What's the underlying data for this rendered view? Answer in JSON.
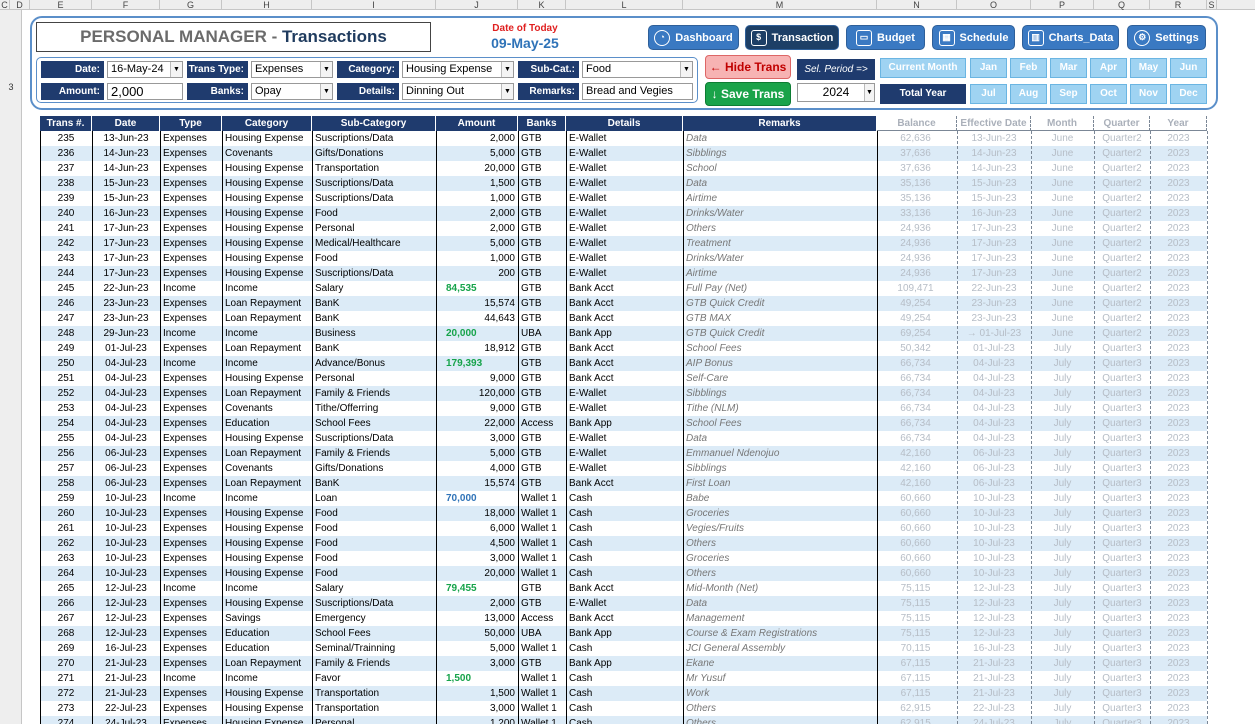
{
  "sheet": {
    "columns": [
      "C",
      "D",
      "E",
      "F",
      "G",
      "H",
      "I",
      "J",
      "K",
      "L",
      "M",
      "N",
      "O",
      "P",
      "Q",
      "R",
      "S"
    ],
    "row_number": "3"
  },
  "header": {
    "app_title": "PERSONAL MANAGER",
    "separator": " - ",
    "page_title": "Transactions",
    "today_label": "Date of Today",
    "today_value": "09-May-25"
  },
  "nav": [
    {
      "label": "Dashboard",
      "icon": "gauge-icon"
    },
    {
      "label": "Transaction",
      "icon": "register-icon"
    },
    {
      "label": "Budget",
      "icon": "wallet-icon"
    },
    {
      "label": "Schedule",
      "icon": "calendar-icon"
    },
    {
      "label": "Charts_Data",
      "icon": "bar-chart-icon"
    },
    {
      "label": "Settings",
      "icon": "gear-icon"
    }
  ],
  "form": {
    "date_label": "Date:",
    "date_value": "16-May-24",
    "type_label": "Trans Type:",
    "type_value": "Expenses",
    "category_label": "Category:",
    "category_value": "Housing Expense",
    "subcat_label": "Sub-Cat.:",
    "subcat_value": "Food",
    "amount_label": "Amount:",
    "amount_value": "2,000",
    "banks_label": "Banks:",
    "banks_value": "Opay",
    "details_label": "Details:",
    "details_value": "Dinning Out",
    "remarks_label": "Remarks:",
    "remarks_value": "Bread and Vegies"
  },
  "buttons": {
    "hide_trans": "Hide Trans",
    "save_trans": "Save Trans"
  },
  "period": {
    "label": "Sel. Period =>",
    "year": "2024",
    "current_month": "Current Month",
    "total_year": "Total Year",
    "months": [
      "Jan",
      "Feb",
      "Mar",
      "Apr",
      "May",
      "Jun",
      "Jul",
      "Aug",
      "Sep",
      "Oct",
      "Nov",
      "Dec"
    ]
  },
  "colors": {
    "accent": "#3a79c2",
    "header_navy": "#1f3b6e",
    "income_green": "#16a34a",
    "income_blue": "#2f73b8",
    "stripe": "#dcebf7"
  },
  "table": {
    "headers": [
      "Trans #.",
      "Date",
      "Type",
      "Category",
      "Sub-Category",
      "Amount",
      "Banks",
      "Details",
      "Remarks",
      "Balance",
      "Effective Date",
      "Month",
      "Quarter",
      "Year"
    ],
    "rows": [
      [
        "235",
        "13-Jun-23",
        "Expenses",
        "Housing Expense",
        "Suscriptions/Data",
        "2,000",
        "GTB",
        "E-Wallet",
        "Data",
        "62,636",
        "13-Jun-23",
        "June",
        "Quarter2",
        "2023"
      ],
      [
        "236",
        "14-Jun-23",
        "Expenses",
        "Covenants",
        "Gifts/Donations",
        "5,000",
        "GTB",
        "E-Wallet",
        "Sibblings",
        "37,636",
        "14-Jun-23",
        "June",
        "Quarter2",
        "2023"
      ],
      [
        "237",
        "14-Jun-23",
        "Expenses",
        "Housing Expense",
        "Transportation",
        "20,000",
        "GTB",
        "E-Wallet",
        "School",
        "37,636",
        "14-Jun-23",
        "June",
        "Quarter2",
        "2023"
      ],
      [
        "238",
        "15-Jun-23",
        "Expenses",
        "Housing Expense",
        "Suscriptions/Data",
        "1,500",
        "GTB",
        "E-Wallet",
        "Data",
        "35,136",
        "15-Jun-23",
        "June",
        "Quarter2",
        "2023"
      ],
      [
        "239",
        "15-Jun-23",
        "Expenses",
        "Housing Expense",
        "Suscriptions/Data",
        "1,000",
        "GTB",
        "E-Wallet",
        "Airtime",
        "35,136",
        "15-Jun-23",
        "June",
        "Quarter2",
        "2023"
      ],
      [
        "240",
        "16-Jun-23",
        "Expenses",
        "Housing Expense",
        "Food",
        "2,000",
        "GTB",
        "E-Wallet",
        "Drinks/Water",
        "33,136",
        "16-Jun-23",
        "June",
        "Quarter2",
        "2023"
      ],
      [
        "241",
        "17-Jun-23",
        "Expenses",
        "Housing Expense",
        "Personal",
        "2,000",
        "GTB",
        "E-Wallet",
        "Others",
        "24,936",
        "17-Jun-23",
        "June",
        "Quarter2",
        "2023"
      ],
      [
        "242",
        "17-Jun-23",
        "Expenses",
        "Housing Expense",
        "Medical/Healthcare",
        "5,000",
        "GTB",
        "E-Wallet",
        "Treatment",
        "24,936",
        "17-Jun-23",
        "June",
        "Quarter2",
        "2023"
      ],
      [
        "243",
        "17-Jun-23",
        "Expenses",
        "Housing Expense",
        "Food",
        "1,000",
        "GTB",
        "E-Wallet",
        "Drinks/Water",
        "24,936",
        "17-Jun-23",
        "June",
        "Quarter2",
        "2023"
      ],
      [
        "244",
        "17-Jun-23",
        "Expenses",
        "Housing Expense",
        "Suscriptions/Data",
        "200",
        "GTB",
        "E-Wallet",
        "Airtime",
        "24,936",
        "17-Jun-23",
        "June",
        "Quarter2",
        "2023"
      ],
      [
        "245",
        "22-Jun-23",
        "Income",
        "Income",
        "Salary",
        "84,535",
        "GTB",
        "Bank Acct",
        "Full Pay (Net)",
        "109,471",
        "22-Jun-23",
        "June",
        "Quarter2",
        "2023"
      ],
      [
        "246",
        "23-Jun-23",
        "Expenses",
        "Loan Repayment",
        "BanK",
        "15,574",
        "GTB",
        "Bank Acct",
        "GTB Quick Credit",
        "49,254",
        "23-Jun-23",
        "June",
        "Quarter2",
        "2023"
      ],
      [
        "247",
        "23-Jun-23",
        "Expenses",
        "Loan Repayment",
        "BanK",
        "44,643",
        "GTB",
        "Bank Acct",
        "GTB MAX",
        "49,254",
        "23-Jun-23",
        "June",
        "Quarter2",
        "2023"
      ],
      [
        "248",
        "29-Jun-23",
        "Income",
        "Income",
        "Business",
        "20,000",
        "UBA",
        "Bank App",
        "GTB Quick Credit",
        "69,254",
        "→ 01-Jul-23",
        "June",
        "Quarter2",
        "2023"
      ],
      [
        "249",
        "01-Jul-23",
        "Expenses",
        "Loan Repayment",
        "BanK",
        "18,912",
        "GTB",
        "Bank Acct",
        "School Fees",
        "50,342",
        "01-Jul-23",
        "July",
        "Quarter3",
        "2023"
      ],
      [
        "250",
        "04-Jul-23",
        "Income",
        "Income",
        "Advance/Bonus",
        "179,393",
        "GTB",
        "Bank Acct",
        "AIP Bonus",
        "66,734",
        "04-Jul-23",
        "July",
        "Quarter3",
        "2023"
      ],
      [
        "251",
        "04-Jul-23",
        "Expenses",
        "Housing Expense",
        "Personal",
        "9,000",
        "GTB",
        "Bank Acct",
        "Self-Care",
        "66,734",
        "04-Jul-23",
        "July",
        "Quarter3",
        "2023"
      ],
      [
        "252",
        "04-Jul-23",
        "Expenses",
        "Loan Repayment",
        "Family & Friends",
        "120,000",
        "GTB",
        "E-Wallet",
        "Sibblings",
        "66,734",
        "04-Jul-23",
        "July",
        "Quarter3",
        "2023"
      ],
      [
        "253",
        "04-Jul-23",
        "Expenses",
        "Covenants",
        "Tithe/Offerring",
        "9,000",
        "GTB",
        "E-Wallet",
        "Tithe (NLM)",
        "66,734",
        "04-Jul-23",
        "July",
        "Quarter3",
        "2023"
      ],
      [
        "254",
        "04-Jul-23",
        "Expenses",
        "Education",
        "School Fees",
        "22,000",
        "Access",
        "Bank App",
        "School Fees",
        "66,734",
        "04-Jul-23",
        "July",
        "Quarter3",
        "2023"
      ],
      [
        "255",
        "04-Jul-23",
        "Expenses",
        "Housing Expense",
        "Suscriptions/Data",
        "3,000",
        "GTB",
        "E-Wallet",
        "Data",
        "66,734",
        "04-Jul-23",
        "July",
        "Quarter3",
        "2023"
      ],
      [
        "256",
        "06-Jul-23",
        "Expenses",
        "Loan Repayment",
        "Family & Friends",
        "5,000",
        "GTB",
        "E-Wallet",
        "Emmanuel Ndenojuo",
        "42,160",
        "06-Jul-23",
        "July",
        "Quarter3",
        "2023"
      ],
      [
        "257",
        "06-Jul-23",
        "Expenses",
        "Covenants",
        "Gifts/Donations",
        "4,000",
        "GTB",
        "E-Wallet",
        "Sibblings",
        "42,160",
        "06-Jul-23",
        "July",
        "Quarter3",
        "2023"
      ],
      [
        "258",
        "06-Jul-23",
        "Expenses",
        "Loan Repayment",
        "BanK",
        "15,574",
        "GTB",
        "Bank Acct",
        "First Loan",
        "42,160",
        "06-Jul-23",
        "July",
        "Quarter3",
        "2023"
      ],
      [
        "259",
        "10-Jul-23",
        "Income",
        "Income",
        "Loan",
        "70,000",
        "Wallet 1",
        "Cash",
        "Babe",
        "60,660",
        "10-Jul-23",
        "July",
        "Quarter3",
        "2023"
      ],
      [
        "260",
        "10-Jul-23",
        "Expenses",
        "Housing Expense",
        "Food",
        "18,000",
        "Wallet 1",
        "Cash",
        "Groceries",
        "60,660",
        "10-Jul-23",
        "July",
        "Quarter3",
        "2023"
      ],
      [
        "261",
        "10-Jul-23",
        "Expenses",
        "Housing Expense",
        "Food",
        "6,000",
        "Wallet 1",
        "Cash",
        "Vegies/Fruits",
        "60,660",
        "10-Jul-23",
        "July",
        "Quarter3",
        "2023"
      ],
      [
        "262",
        "10-Jul-23",
        "Expenses",
        "Housing Expense",
        "Food",
        "4,500",
        "Wallet 1",
        "Cash",
        "Others",
        "60,660",
        "10-Jul-23",
        "July",
        "Quarter3",
        "2023"
      ],
      [
        "263",
        "10-Jul-23",
        "Expenses",
        "Housing Expense",
        "Food",
        "3,000",
        "Wallet 1",
        "Cash",
        "Groceries",
        "60,660",
        "10-Jul-23",
        "July",
        "Quarter3",
        "2023"
      ],
      [
        "264",
        "10-Jul-23",
        "Expenses",
        "Housing Expense",
        "Food",
        "20,000",
        "Wallet 1",
        "Cash",
        "Others",
        "60,660",
        "10-Jul-23",
        "July",
        "Quarter3",
        "2023"
      ],
      [
        "265",
        "12-Jul-23",
        "Income",
        "Income",
        "Salary",
        "79,455",
        "GTB",
        "Bank Acct",
        "Mid-Month (Net)",
        "75,115",
        "12-Jul-23",
        "July",
        "Quarter3",
        "2023"
      ],
      [
        "266",
        "12-Jul-23",
        "Expenses",
        "Housing Expense",
        "Suscriptions/Data",
        "2,000",
        "GTB",
        "E-Wallet",
        "Data",
        "75,115",
        "12-Jul-23",
        "July",
        "Quarter3",
        "2023"
      ],
      [
        "267",
        "12-Jul-23",
        "Expenses",
        "Savings",
        "Emergency",
        "13,000",
        "Access",
        "Bank Acct",
        "Management",
        "75,115",
        "12-Jul-23",
        "July",
        "Quarter3",
        "2023"
      ],
      [
        "268",
        "12-Jul-23",
        "Expenses",
        "Education",
        "School Fees",
        "50,000",
        "UBA",
        "Bank App",
        "Course & Exam Registrations",
        "75,115",
        "12-Jul-23",
        "July",
        "Quarter3",
        "2023"
      ],
      [
        "269",
        "16-Jul-23",
        "Expenses",
        "Education",
        "Seminal/Trainning",
        "5,000",
        "Wallet 1",
        "Cash",
        "JCI General Assembly",
        "70,115",
        "16-Jul-23",
        "July",
        "Quarter3",
        "2023"
      ],
      [
        "270",
        "21-Jul-23",
        "Expenses",
        "Loan Repayment",
        "Family & Friends",
        "3,000",
        "GTB",
        "Bank App",
        "Ekane",
        "67,115",
        "21-Jul-23",
        "July",
        "Quarter3",
        "2023"
      ],
      [
        "271",
        "21-Jul-23",
        "Income",
        "Income",
        "Favor",
        "1,500",
        "Wallet 1",
        "Cash",
        "Mr Yusuf",
        "67,115",
        "21-Jul-23",
        "July",
        "Quarter3",
        "2023"
      ],
      [
        "272",
        "21-Jul-23",
        "Expenses",
        "Housing Expense",
        "Transportation",
        "1,500",
        "Wallet 1",
        "Cash",
        "Work",
        "67,115",
        "21-Jul-23",
        "July",
        "Quarter3",
        "2023"
      ],
      [
        "273",
        "22-Jul-23",
        "Expenses",
        "Housing Expense",
        "Transportation",
        "3,000",
        "Wallet 1",
        "Cash",
        "Others",
        "62,915",
        "22-Jul-23",
        "July",
        "Quarter3",
        "2023"
      ],
      [
        "274",
        "24-Jul-23",
        "Expenses",
        "Housing Expense",
        "Personal",
        "1,200",
        "Wallet 1",
        "Cash",
        "Others",
        "62,915",
        "24-Jul-23",
        "July",
        "Quarter3",
        "2023"
      ]
    ],
    "income_blue_rows": [
      "259"
    ]
  }
}
